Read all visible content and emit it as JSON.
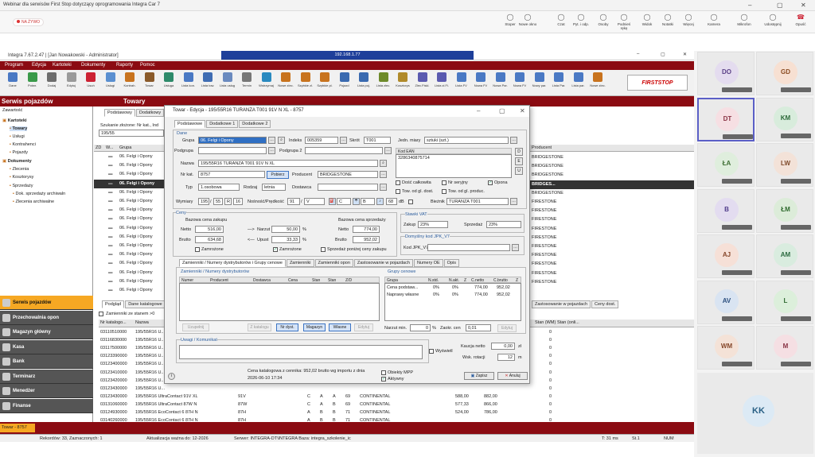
{
  "window": {
    "title": "Webinar dla serwisów First Stop dotyczący oprogramowania Integra Car 7"
  },
  "meeting": {
    "live": "NA ŻYWO",
    "tools": [
      {
        "label": "Stoper",
        "icon": "timer-icon"
      },
      {
        "label": "Nowe okno",
        "icon": "new-window-icon"
      },
      {
        "label": "Czat",
        "icon": "chat-icon"
      },
      {
        "label": "Pyt. i odp.",
        "icon": "qa-icon"
      },
      {
        "label": "Osoby",
        "icon": "people-icon"
      },
      {
        "label": "Podnieś rękę",
        "icon": "raise-hand-icon"
      },
      {
        "label": "Widok",
        "icon": "view-icon"
      },
      {
        "label": "Notatki",
        "icon": "notes-icon"
      },
      {
        "label": "Więcej",
        "icon": "more-icon"
      },
      {
        "label": "Kamera",
        "icon": "camera-icon"
      },
      {
        "label": "Mikrofon",
        "icon": "mic-icon"
      },
      {
        "label": "Udostępnij",
        "icon": "share-icon"
      },
      {
        "label": "Opuść",
        "icon": "leave-icon"
      }
    ]
  },
  "vpn": {
    "address": "192.168.1.77"
  },
  "app": {
    "title": "Integra 7.67.2.47 | [Jan Nowakowski - Administrator]",
    "menu": [
      "Program",
      "Edycja",
      "Kartoteki",
      "Dokumenty",
      "Raporty",
      "Pomoc"
    ],
    "toolbar": [
      "Dane",
      "Potwr.",
      "Dodaj",
      "Edytuj",
      "Usuń",
      "Usługi",
      "Kontrah.",
      "Towar",
      "Usługa",
      "Lista kon.",
      "Lista tow.",
      "Lista usług",
      "Termin",
      "Wstrzymaj",
      "Nowe zlec.",
      "Szybkie zl.",
      "Szybkie pl.",
      "Pojazd",
      "Lista poj.",
      "Lista zlec.",
      "Kosztorys",
      "Zlec.Fiskl.",
      "Lista zl.Fi.",
      "Lista FV",
      "Nowa FV",
      "Nowa Par.",
      "Nowa FV",
      "Nowy par.",
      "Lista Par.",
      "Lista par.",
      "Nowe zlec."
    ],
    "brand": "FIRSTSTOP"
  },
  "left": {
    "title": "Serwis pojazdów",
    "subtitle": "Zawartość",
    "tree": [
      "Kartoteki",
      "Towary",
      "Usługi",
      "Kontrahenci",
      "Pojazdy",
      "Dokumenty",
      "Zlecenia",
      "Kosztorysy",
      "Sprzedaży",
      "Dok. sprzedaży archiwaln",
      "Zlecenia archiwalne"
    ],
    "nav": [
      "Serwis pojazdów",
      "Przechowalnia opon",
      "Magazyn główny",
      "Kasa",
      "Bank",
      "Terminarz",
      "Menedżer",
      "Finanse"
    ]
  },
  "content": {
    "title": "Towary",
    "tabs": [
      "Podstawowy",
      "Dodatkowy"
    ],
    "search_label": "Szukanie złożone: Nr kat., Ind",
    "search_value": "195/55",
    "headers": [
      "ZD",
      "W...",
      "Grupa"
    ],
    "group_rows": [
      "06. Felgi i Opony",
      "06. Felgi i Opony",
      "06. Felgi i Opony",
      "06. Felgi i Opony",
      "06. Felgi i Opony",
      "06. Felgi i Opony",
      "06. Felgi i Opony",
      "06. Felgi i Opony",
      "06. Felgi i Opony",
      "06. Felgi i Opony",
      "06. Felgi i Opony",
      "06. Felgi i Opony",
      "06. Felgi i Opony",
      "06. Felgi i Opony",
      "06. Felgi i Opony",
      "06. Felgi i Opony"
    ],
    "right_header": "Producent",
    "producers": [
      "BRIDGESTONE",
      "BRIDGESTONE",
      "BRIDGESTONE",
      "BRIDGES...",
      "BRIDGESTONE",
      "FIRESTONE",
      "FIRESTONE",
      "FIRESTONE",
      "FIRESTONE",
      "FIRESTONE",
      "FIRESTONE",
      "FIRESTONE",
      "FIRESTONE",
      "FIRESTONE",
      "FIRESTONE"
    ],
    "lower_tabs": [
      "Podgląd",
      "Dane katalogowe",
      "Zastosowanie w pojazdach",
      "Ceny dost."
    ],
    "zam_check": "Zamienniki ze stanem >0",
    "lower_headers": [
      "Nr katalogo...",
      "Nazwa",
      "Stan (WM)",
      "Stan (onli..."
    ],
    "lower_rows": [
      {
        "nr": "03110510000",
        "name": "195/55R16 U...",
        "c1": "",
        "c2": "",
        "c3": "",
        "c4": "",
        "c5": "",
        "c6": "",
        "p1": "",
        "p2": "",
        "s": "0"
      },
      {
        "nr": "03116830000",
        "name": "195/55R16 U...",
        "c1": "",
        "c2": "",
        "c3": "",
        "c4": "",
        "c5": "",
        "c6": "",
        "p1": "",
        "p2": "",
        "s": "0"
      },
      {
        "nr": "03117500000",
        "name": "195/55R16 U...",
        "c1": "",
        "c2": "",
        "c3": "",
        "c4": "",
        "c5": "",
        "c6": "",
        "p1": "",
        "p2": "",
        "s": "0"
      },
      {
        "nr": "03123390000",
        "name": "195/55R16 U...",
        "c1": "",
        "c2": "",
        "c3": "",
        "c4": "",
        "c5": "",
        "c6": "",
        "p1": "",
        "p2": "",
        "s": "0"
      },
      {
        "nr": "03123400000",
        "name": "195/55R16 U...",
        "c1": "",
        "c2": "",
        "c3": "",
        "c4": "",
        "c5": "",
        "c6": "",
        "p1": "",
        "p2": "",
        "s": "0"
      },
      {
        "nr": "03123410000",
        "name": "195/55R16 U...",
        "c1": "",
        "c2": "",
        "c3": "",
        "c4": "",
        "c5": "",
        "c6": "",
        "p1": "",
        "p2": "",
        "s": "0"
      },
      {
        "nr": "03123420000",
        "name": "195/55R16 U...",
        "c1": "",
        "c2": "",
        "c3": "",
        "c4": "",
        "c5": "",
        "c6": "",
        "p1": "",
        "p2": "",
        "s": "0"
      },
      {
        "nr": "03123430000",
        "name": "195/55R16 U...",
        "c1": "",
        "c2": "",
        "c3": "",
        "c4": "",
        "c5": "",
        "c6": "",
        "p1": "",
        "p2": "",
        "s": "0"
      },
      {
        "nr": "03123430000",
        "name": "195/55R16 UltraContact 91V XL",
        "c1": "91V",
        "c2": "C",
        "c3": "A",
        "c4": "A",
        "c5": "69",
        "c6": "CONTINENTAL",
        "p1": "588,00",
        "p2": "882,00",
        "s": "0"
      },
      {
        "nr": "03131060000",
        "name": "195/55R16 UltraContact 87W N",
        "c1": "87W",
        "c2": "C",
        "c3": "A",
        "c4": "B",
        "c5": "69",
        "c6": "CONTINENTAL",
        "p1": "577,33",
        "p2": "866,00",
        "s": "0"
      },
      {
        "nr": "03124930000",
        "name": "195/55R16 EcoContact 6 87H N",
        "c1": "87H",
        "c2": "A",
        "c3": "B",
        "c4": "B",
        "c5": "71",
        "c6": "CONTINENTAL",
        "p1": "524,00",
        "p2": "786,00",
        "s": "0"
      },
      {
        "nr": "03140260000",
        "name": "195/55R16 EcoContact 6 87H N",
        "c1": "87H",
        "c2": "A",
        "c3": "B",
        "c4": "B",
        "c5": "71",
        "c6": "CONTINENTAL",
        "p1": "",
        "p2": "",
        "s": "0"
      }
    ]
  },
  "dialog": {
    "title": "Towar - Edycja - 195/55R16 TURANZA T001 91V N XL - 8757",
    "tabs": [
      "Podstawowe",
      "Dodatkowe 1",
      "Dodatkowe 2"
    ],
    "dane": "Dane",
    "grupa_label": "Grupa",
    "grupa": "06. Felgi i Opony",
    "indeks_label": "Indeks",
    "indeks": "005359",
    "skrot_label": "Skrót",
    "skrot": "T001",
    "jm_label": "Jedn. miary",
    "jm": "sztuki (szt.)",
    "podgrupa_label": "Podgrupa",
    "podgrupa2_label": "Podgrupa 2",
    "kod_ean_header": "Kod EAN",
    "kod_ean": "3286340875714",
    "side_btns": [
      "D",
      "E",
      "U"
    ],
    "nazwa_label": "Nazwa",
    "nazwa": "195/55R16 TURANZA T001 91V N XL",
    "nrkat_label": "Nr kat.",
    "nrkat": "8757",
    "pobierz": "Pobierz",
    "producent_label": "Producent",
    "producent": "BRIDGESTONE",
    "typ_label": "Typ",
    "typ": "1.osobowa",
    "rodzaj_label": "Rodzaj",
    "rodzaj": "letnia",
    "dostawca_label": "Dostawca",
    "checks_right": [
      "Dość całkowita",
      "Nr seryjny",
      "Opona",
      "Tow. od gl. dost.",
      "Tow. od gl. produc."
    ],
    "wymiary_label": "Wymiary",
    "w1": "195",
    "w2": "55",
    "w3": "R",
    "w4": "16",
    "nosnosc_label": "Nośność/Prędkość",
    "n1": "91",
    "n2": "V",
    "label_c": "C",
    "label_b": "B",
    "db": "68",
    "db_unit": "dB",
    "biez_label": "Bieżnik",
    "biez": "TURANZA T001",
    "ceny": "Ceny",
    "bazowa_zakupu": "Bazowa cena zakupu",
    "bazowa_sprzedazy": "Bazowa cena sprzedaży",
    "netto_label": "Netto",
    "brutto_label": "Brutto",
    "netto_zak": "516,00",
    "brutto_zak": "634,68",
    "narzut_label": "Narzut",
    "narzut": "50,00",
    "upust_label": "Upust",
    "upust": "33,33",
    "pct": "%",
    "netto_sp": "774,00",
    "brutto_sp": "952,02",
    "zamrozone": "Zamrożone",
    "sprzedaz_ponizej": "Sprzedaż poniżej ceny zakupu",
    "vat": "Stawki VAT",
    "zakup_label": "Zakup",
    "zakup": "23%",
    "sprzedaz_label": "Sprzedaż",
    "sprzedaz": "23%",
    "jpk_label": "Domyślny kod JPK_V7",
    "jpk_kod_label": "Kod JPK_V7",
    "sub_tabs": [
      "Zamienniki / Numery dystrybutorów i Grupy cenowe",
      "Zamienniki",
      "Zamienniki opon",
      "Zastosowanie w pojazdach",
      "Numery OE",
      "Opis"
    ],
    "zam_sect": "Zamienniki / Numery dystrybutorów",
    "zam_headers": [
      "Numer",
      "Producent",
      "Dostawca",
      "Cena",
      "Stan",
      "Stan",
      "Z/D"
    ],
    "grupy_sect": "Grupy cenowe",
    "grupy_headers": [
      "Grupa",
      "N.std.",
      "N.akt.",
      "Z",
      "C.netto",
      "C.brutto",
      "Z"
    ],
    "grupy_rows": [
      {
        "g": "Cena podstaw...",
        "n1": "0%",
        "n2": "0%",
        "z": "",
        "cn": "774,00",
        "cb": "952,02"
      },
      {
        "g": "Naprawy własne",
        "n1": "0%",
        "n2": "0%",
        "z": "",
        "cn": "774,00",
        "cb": "952,02"
      }
    ],
    "zam_btns": [
      "Uzupełnij",
      "Z katalogu",
      "Nr dyst.",
      "Magazyn",
      "Własne",
      "Edytuj"
    ],
    "narzut_min_label": "Narzut min.",
    "narzut_min": "0",
    "zaokr_label": "Zaokr. cen",
    "zaokr": "0,01",
    "edytuj": "Edytuj",
    "uwagi": "Uwagi / Komunikat",
    "wyswietl": "Wyświetl",
    "kaucja_label": "Kaucja netto",
    "kaucja": "0,00",
    "kaucja_unit": "zł",
    "wsk_label": "Wsk. rotacji",
    "wsk": "12",
    "wsk_unit": "m",
    "info1": "Cena katalogowa z cennika: 952,02 brutto wg importu z dnia",
    "info2": "2026-06-10 17:34",
    "obiekty": "Obiekty MPP",
    "aktywny": "Aktywny",
    "zapisz": "Zapisz",
    "anuluj": "Anuluj"
  },
  "status": {
    "rekordow": "Rekordów: 33, Zaznaczonych: 1",
    "aktualizacja": "Aktualizacja ważna do: 12-2026",
    "serwer": "Serwer: INTEGRA-DT\\INTEGRA  Baza: integra_szkolenie_ic",
    "time": "T: 31 ms",
    "st": "St.1",
    "num": "NUM"
  },
  "task": "Towar - 8757",
  "participants": [
    {
      "i": "DO",
      "bg": "#e4dcef",
      "fg": "#5a3f86"
    },
    {
      "i": "GD",
      "bg": "#f7e0d2",
      "fg": "#8a4a20"
    },
    {
      "i": "DT",
      "bg": "#f6dfe3",
      "fg": "#8a3344"
    },
    {
      "i": "KM",
      "bg": "#d8ecdc",
      "fg": "#2d6a3a"
    },
    {
      "i": "ŁA",
      "bg": "#dfeedd",
      "fg": "#3f6f35"
    },
    {
      "i": "LW",
      "bg": "#f3e2d8",
      "fg": "#7f4a2a"
    },
    {
      "i": "B",
      "bg": "#e3dcf0",
      "fg": "#4f3b8a"
    },
    {
      "i": "ŁM",
      "bg": "#dcecd9",
      "fg": "#2f6a2e"
    },
    {
      "i": "AJ",
      "bg": "#f6e0d7",
      "fg": "#86462a"
    },
    {
      "i": "AM",
      "bg": "#d9ecdf",
      "fg": "#2c6a40"
    },
    {
      "i": "AV",
      "bg": "#d9e4f2",
      "fg": "#2a4e7e"
    },
    {
      "i": "L",
      "bg": "#dcefdb",
      "fg": "#2f6a31"
    },
    {
      "i": "WM",
      "bg": "#f4e2d7",
      "fg": "#85472a"
    },
    {
      "i": "M",
      "bg": "#f5dfe3",
      "fg": "#883344"
    }
  ],
  "big_participant": "KK"
}
